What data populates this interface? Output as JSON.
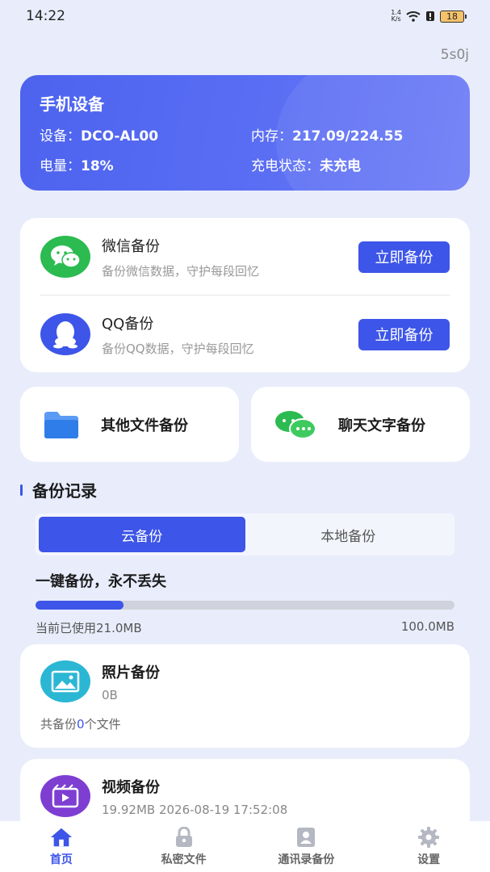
{
  "status_bar": {
    "time": "14:22",
    "speed_top": "1.4",
    "speed_bottom": "K/s",
    "battery": "18"
  },
  "user_id": "5s0j",
  "device_card": {
    "title": "手机设备",
    "device_label": "设备：",
    "device_value": "DCO-AL00",
    "memory_label": "内存：",
    "memory_value": "217.09/224.55",
    "battery_label": "电量：",
    "battery_value": "18%",
    "charging_label": "充电状态：",
    "charging_value": "未充电"
  },
  "backups": {
    "wechat": {
      "name": "微信备份",
      "desc": "备份微信数据，守护每段回忆",
      "button": "立即备份",
      "icon": "wechat-icon"
    },
    "qq": {
      "name": "QQ备份",
      "desc": "备份QQ数据，守护每段回忆",
      "button": "立即备份",
      "icon": "qq-icon"
    }
  },
  "tiles": {
    "other_files": "其他文件备份",
    "chat_text": "聊天文字备份"
  },
  "records": {
    "section_title": "备份记录",
    "tabs": [
      "云备份",
      "本地备份"
    ],
    "active_tab": 0,
    "slogan": "一键备份，永不丢失",
    "used_text": "当前已使用21.0MB",
    "total_text": "100.0MB",
    "usage_fraction": 0.21,
    "photo": {
      "title": "照片备份",
      "size": "0B",
      "count_prefix": "共备份",
      "count": "0",
      "count_suffix": "个文件"
    },
    "video": {
      "title": "视频备份",
      "size": "19.92MB  2026-08-19 17:52:08"
    }
  },
  "nav": {
    "items": [
      {
        "label": "首页",
        "icon": "home-icon"
      },
      {
        "label": "私密文件",
        "icon": "lock-icon"
      },
      {
        "label": "通讯录备份",
        "icon": "contacts-icon"
      },
      {
        "label": "设置",
        "icon": "gear-icon"
      }
    ],
    "active": 0
  },
  "colors": {
    "primary": "#3d55e8",
    "wechat": "#2bbb50",
    "photo": "#2bb7d4",
    "video": "#7e3ed2"
  }
}
